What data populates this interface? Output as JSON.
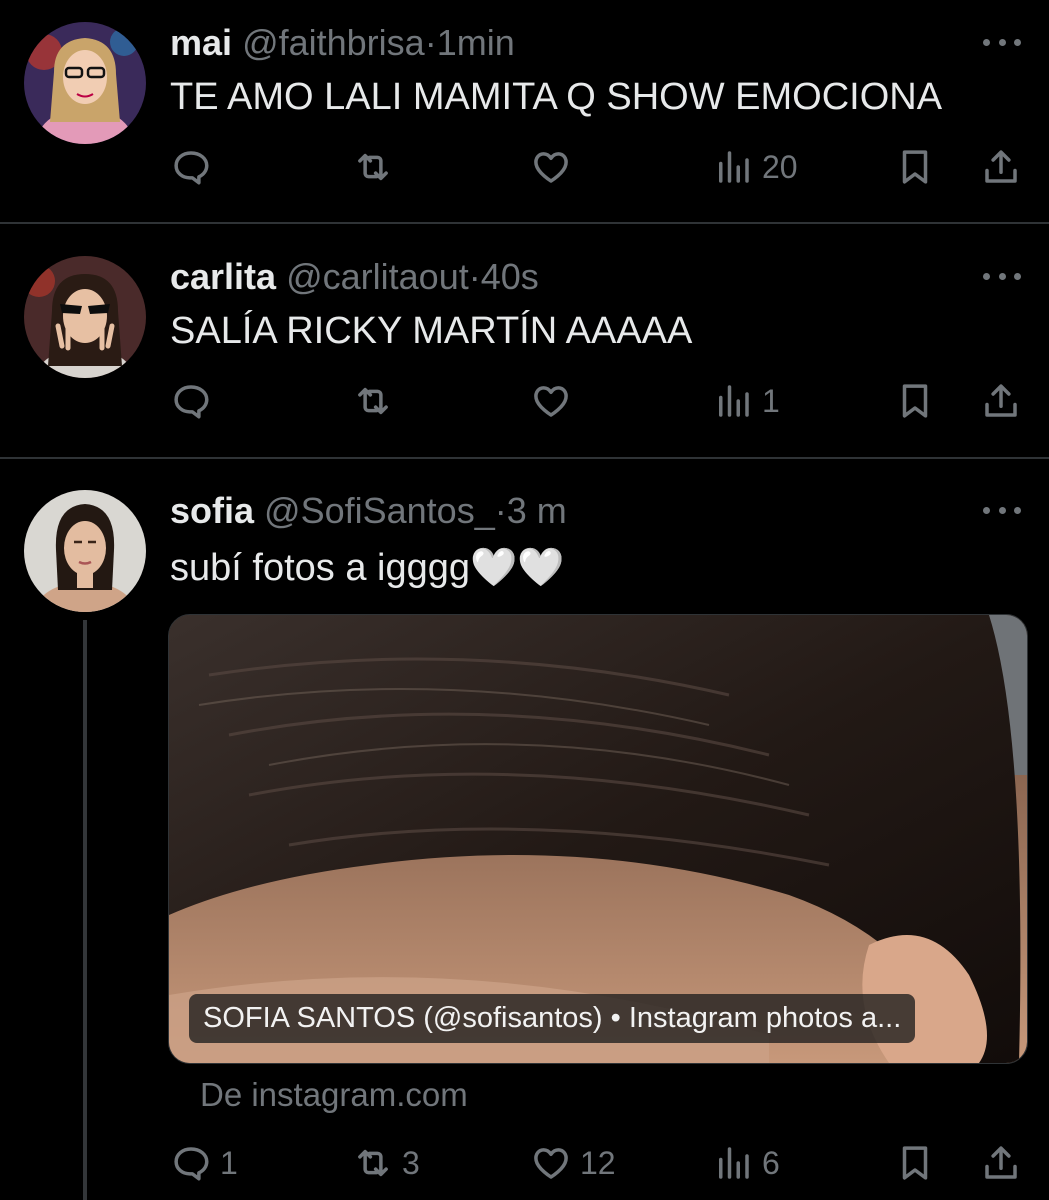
{
  "tweets": [
    {
      "name": "mai",
      "handle": "@faithbrisa",
      "sep": "·",
      "time": "1min",
      "text": "TE AMO LALI MAMITA Q SHOW EMOCIONA",
      "replies": "",
      "retweets": "",
      "likes": "",
      "views": "20"
    },
    {
      "name": "carlita",
      "handle": "@carlitaout",
      "sep": "·",
      "time": "40s",
      "text": "SALÍA RICKY MARTÍN AAAAA",
      "replies": "",
      "retweets": "",
      "likes": "",
      "views": "1"
    },
    {
      "name": "sofia",
      "handle": "@SofiSantos_",
      "sep": "·",
      "time": "3 m",
      "text": "subí fotos a igggg🤍🤍",
      "card_title": "SOFIA SANTOS (@sofisantos) • Instagram photos a...",
      "card_source": "De instagram.com",
      "replies": "1",
      "retweets": "3",
      "likes": "12",
      "views": "6"
    }
  ],
  "icons": {
    "reply": "reply-icon",
    "retweet": "retweet-icon",
    "like": "heart-icon",
    "views": "views-icon",
    "bookmark": "bookmark-icon",
    "share": "share-icon",
    "more": "more-icon"
  },
  "colors": {
    "background": "#000000",
    "text": "#e7e9ea",
    "muted": "#71767b",
    "divider": "#2f3336"
  }
}
